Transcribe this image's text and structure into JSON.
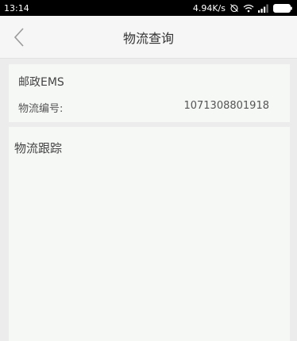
{
  "status_bar": {
    "time": "13:14",
    "speed": "4.94K/s",
    "icons": [
      "alarm-off-icon",
      "wifi-icon",
      "signal-icon",
      "battery-icon"
    ]
  },
  "header": {
    "back_icon": "chevron-left-icon",
    "title": "物流查询"
  },
  "logistics": {
    "company": "邮政EMS",
    "tracking_label": "物流编号:",
    "tracking_number": "1071308801918"
  },
  "tracking": {
    "title": "物流跟踪"
  },
  "colors": {
    "status_bar_bg": "#000000",
    "header_bg": "#f6f6f6",
    "card_bg": "#f5f8f5",
    "page_bg": "#ececec"
  }
}
